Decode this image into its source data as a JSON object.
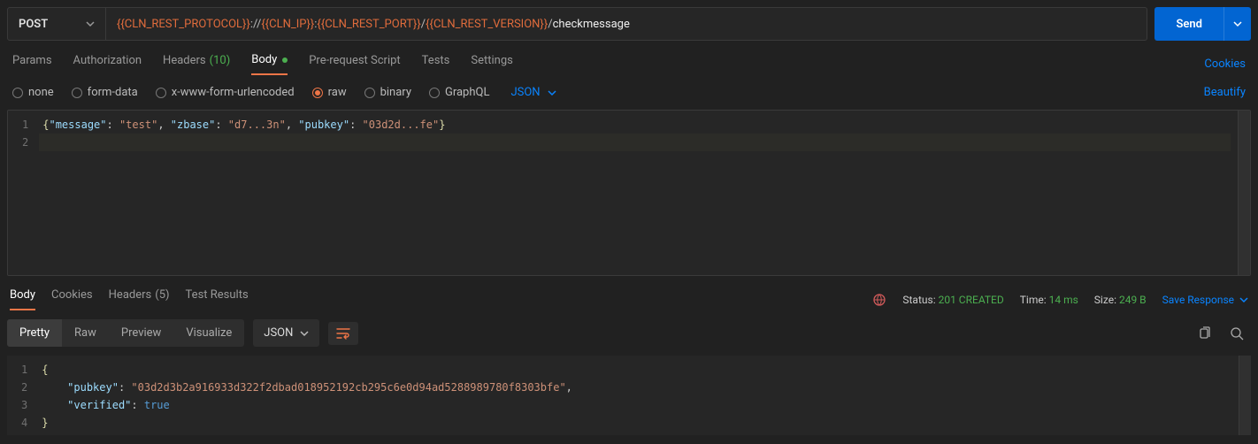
{
  "method": "POST",
  "url": {
    "var1": "{{CLN_REST_PROTOCOL}}",
    "sep1": "://",
    "var2": "{{CLN_IP}}",
    "sep2": ":",
    "var3": "{{CLN_REST_PORT}}",
    "sep3": "/",
    "var4": "{{CLN_REST_VERSION}}",
    "sep4": "/",
    "path": "checkmessage"
  },
  "send_label": "Send",
  "req_tabs": {
    "params": "Params",
    "auth": "Authorization",
    "headers": "Headers",
    "headers_count": "(10)",
    "body": "Body",
    "prereq": "Pre-request Script",
    "tests": "Tests",
    "settings": "Settings"
  },
  "cookies_link": "Cookies",
  "body_types": {
    "none": "none",
    "form_data": "form-data",
    "x_www": "x-www-form-urlencoded",
    "raw": "raw",
    "binary": "binary",
    "graphql": "GraphQL"
  },
  "body_format": "JSON",
  "beautify": "Beautify",
  "req_body_lines": [
    "1",
    "2"
  ],
  "req_body": {
    "message_key": "\"message\"",
    "message_val": "\"test\"",
    "zbase_key": "\"zbase\"",
    "zbase_val": "\"d7...3n\"",
    "pubkey_key": "\"pubkey\"",
    "pubkey_val": "\"03d2d...fe\""
  },
  "resp_tabs": {
    "body": "Body",
    "cookies": "Cookies",
    "headers": "Headers",
    "headers_count": "(5)",
    "test_results": "Test Results"
  },
  "resp_meta": {
    "status_label": "Status:",
    "status_value": "201 CREATED",
    "time_label": "Time:",
    "time_value": "14 ms",
    "size_label": "Size:",
    "size_value": "249 B"
  },
  "save_response": "Save Response",
  "view_tabs": {
    "pretty": "Pretty",
    "raw": "Raw",
    "preview": "Preview",
    "visualize": "Visualize"
  },
  "resp_format": "JSON",
  "resp_lines": [
    "1",
    "2",
    "3",
    "4"
  ],
  "resp_body": {
    "pubkey_key": "\"pubkey\"",
    "pubkey_val": "\"03d2d3b2a916933d322f2dbad018952192cb295c6e0d94ad5288989780f8303bfe\"",
    "verified_key": "\"verified\"",
    "verified_val": "true"
  }
}
